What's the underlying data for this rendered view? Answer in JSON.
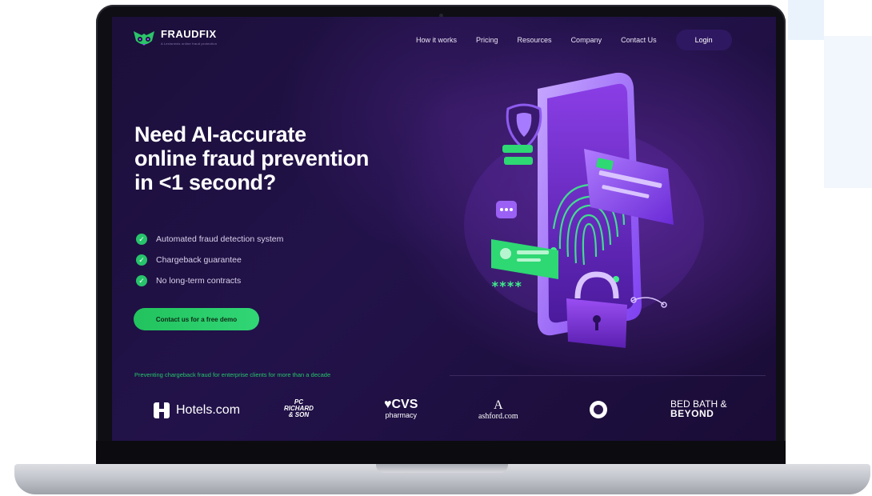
{
  "brand": {
    "name": "FRAUDFIX",
    "tagline": "A Lexisnexis online fraud protection"
  },
  "nav": {
    "links": [
      "How it works",
      "Pricing",
      "Resources",
      "Company",
      "Contact Us"
    ],
    "login_label": "Login"
  },
  "hero": {
    "title_line1": "Need AI-accurate",
    "title_line2": "online fraud prevention",
    "title_line3": "in <1 second?",
    "features": [
      "Automated fraud detection system",
      "Chargeback guarantee",
      "No long-term contracts"
    ],
    "cta_label": "Contact us for a free demo"
  },
  "clients": {
    "tagline": "Preventing chargeback fraud for enterprise clients for more than a decade",
    "hotels": "Hotels.com",
    "pc_line1": "PC",
    "pc_line2": "RICHARD",
    "pc_line3": "& SON",
    "cvs_line1": "♥CVS",
    "cvs_line2": "pharmacy",
    "ashford_mark": "A",
    "ashford_name": "ashford.com",
    "bbb_line1": "BED BATH &",
    "bbb_line2": "BEYOND"
  },
  "illustration": {
    "password_mask": "****"
  },
  "colors": {
    "accent_green": "#27c46b",
    "background_purple": "#22124a",
    "login_button": "#2f1862"
  }
}
